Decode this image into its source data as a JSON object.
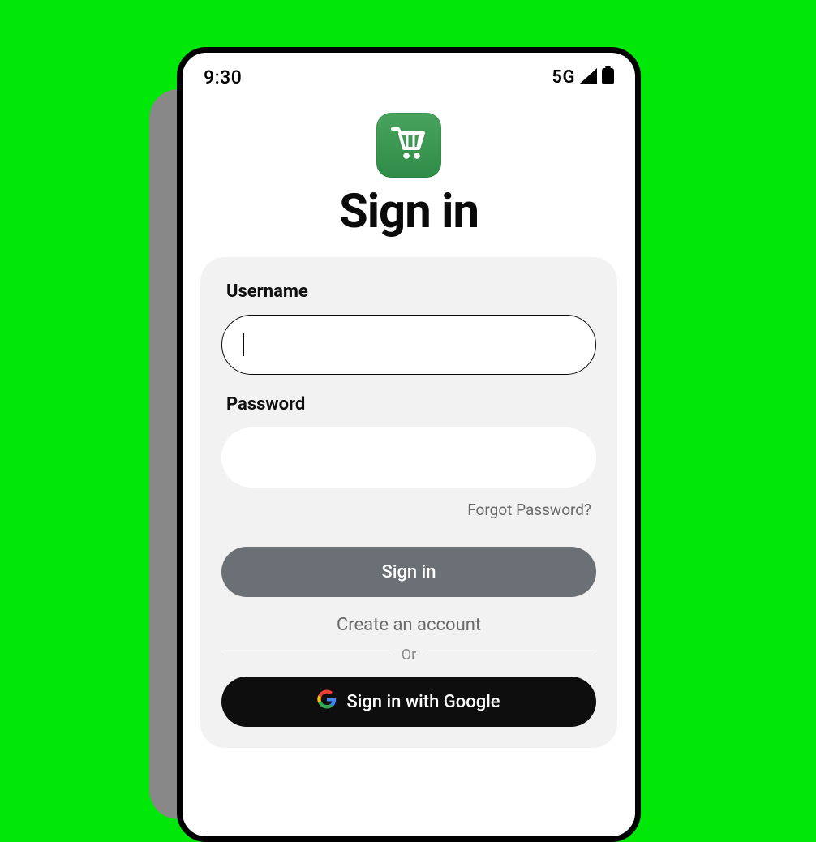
{
  "status_bar": {
    "time": "9:30",
    "network_label": "5G"
  },
  "header": {
    "title": "Sign in",
    "logo_icon_name": "shopping-cart-icon"
  },
  "form": {
    "username_label": "Username",
    "username_value": "",
    "password_label": "Password",
    "password_value": "",
    "forgot_link_label": "Forgot Password?",
    "submit_label": "Sign in",
    "create_account_label": "Create an account",
    "separator_label": "Or",
    "google_button_label": "Sign in with Google"
  },
  "colors": {
    "page_background": "#00E808",
    "logo_tile": "#3A9051",
    "card_background": "#F2F2F2",
    "primary_button": "#6B7076",
    "google_button": "#0E0E0E",
    "muted_text": "#6a6a6a"
  }
}
